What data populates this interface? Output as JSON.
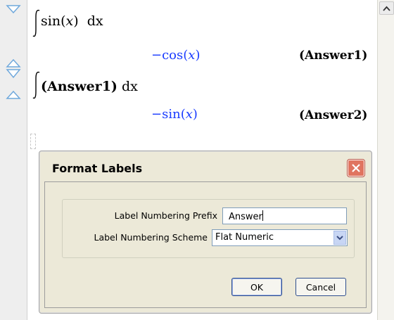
{
  "worksheet": {
    "expr1": {
      "func": "sin",
      "arg": "x",
      "dvar": "dx"
    },
    "result1": {
      "sign": "−",
      "func": "cos",
      "arg": "x"
    },
    "label1": "(Answer1)",
    "expr2": {
      "ref": "(Answer1)",
      "dvar": "dx"
    },
    "result2": {
      "sign": "−",
      "func": "sin",
      "arg": "x"
    },
    "label2": "(Answer2)"
  },
  "dialog": {
    "title": "Format Labels",
    "prefix_label": "Label Numbering Prefix",
    "prefix_value": "Answer",
    "scheme_label": "Label Numbering Scheme",
    "scheme_value": "Flat Numeric",
    "ok_label": "OK",
    "cancel_label": "Cancel"
  },
  "colors": {
    "result_text": "#1a3cff",
    "gutter_arrow": "#6fa8dc",
    "close_button": "#e07460"
  },
  "icons": {
    "gutter_top": "collapse-triangle-icon",
    "gutter_mid": "expand-collapse-icon",
    "gutter_lower": "expand-triangle-icon",
    "scroll_up": "chevron-up-icon",
    "close": "close-icon",
    "dropdown": "chevron-down-icon"
  }
}
